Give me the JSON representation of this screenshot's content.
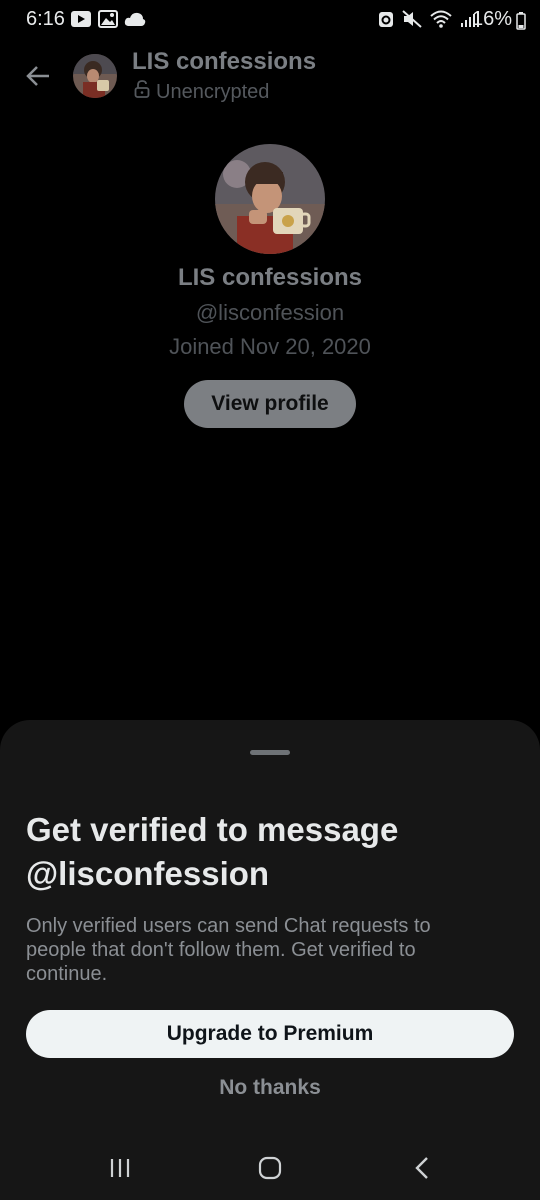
{
  "status_bar": {
    "time": "6:16",
    "battery": "16%",
    "left_icons": [
      "youtube-icon",
      "gallery-icon",
      "cloud-icon"
    ],
    "right_icons": [
      "data-saver-icon",
      "mute-icon",
      "wifi-icon",
      "signal-icon",
      "battery-icon"
    ]
  },
  "header": {
    "title": "LIS confessions",
    "subtitle": "Unencrypted",
    "back_icon": "back-arrow-icon",
    "lock_icon": "open-lock-icon"
  },
  "profile": {
    "name": "LIS confessions",
    "handle": "@lisconfession",
    "joined": "Joined Nov 20, 2020",
    "view_profile_label": "View profile"
  },
  "sheet": {
    "title": "Get verified to message @lisconfession",
    "body": "Only verified users can send Chat requests to people that don't follow them. Get verified to continue.",
    "upgrade_label": "Upgrade to Premium",
    "dismiss_label": "No thanks"
  },
  "nav_bar": {
    "icons": [
      "recent-apps-icon",
      "home-icon",
      "back-icon"
    ]
  },
  "colors": {
    "background": "#000000",
    "sheet": "#161616",
    "primary_button": "#eff3f4",
    "dim_text": "#7b7f84"
  }
}
